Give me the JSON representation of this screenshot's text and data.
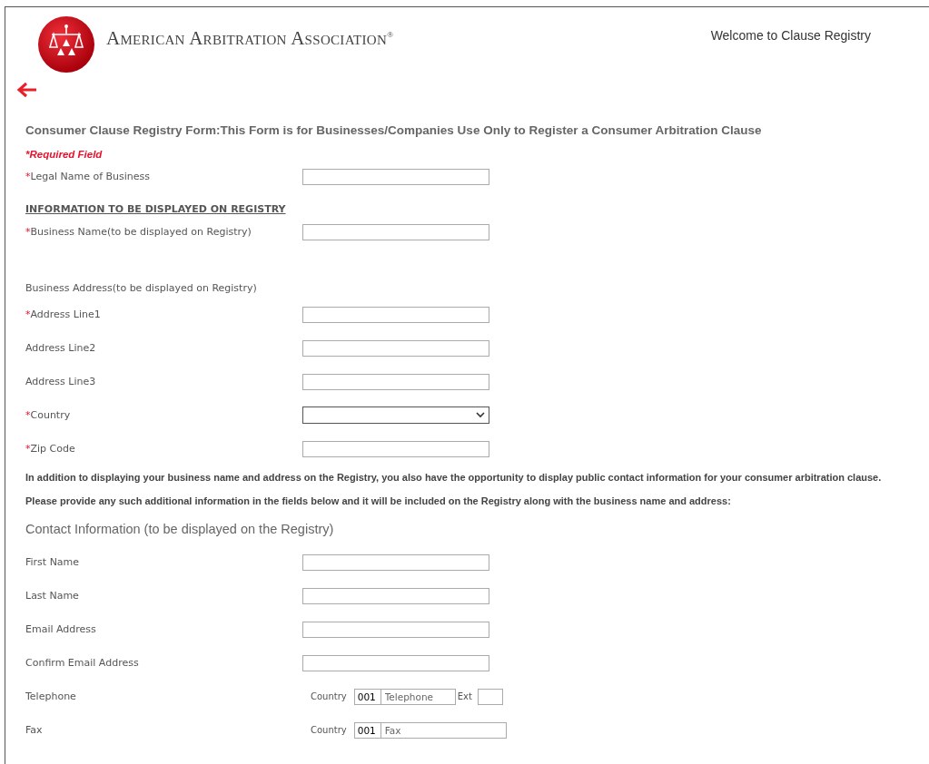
{
  "header": {
    "brand": "American Arbitration Association$^{®}$",
    "welcome": "Welcome to Clause Registry"
  },
  "form": {
    "title": "Consumer Clause Registry Form:This Form is for Businesses/Companies Use Only to Register a Consumer Arbitration Clause",
    "required_note": "*Required Field",
    "items": [
      {
        "kind": "text",
        "marker": "*",
        "label": "Legal Name of Business"
      },
      {
        "kind": "heading",
        "label": "INFORMATION TO BE DISPLAYED ON REGISTRY"
      },
      {
        "kind": "text",
        "marker": "*",
        "label": "Business Name(to be displayed on Registry)"
      },
      {
        "kind": "caption",
        "label": "Business Address(to be displayed on Registry)"
      },
      {
        "kind": "text",
        "marker": "*",
        "label": "Address Line1"
      },
      {
        "kind": "text",
        "label": "Address Line2"
      },
      {
        "kind": "text",
        "label": "Address Line3"
      },
      {
        "kind": "select",
        "marker": "*",
        "label": "Country"
      },
      {
        "kind": "text",
        "marker": "*",
        "label": "Zip Code"
      },
      {
        "kind": "paragraph",
        "label": "In addition to displaying your business name and address on the Registry, you also have the opportunity to display public contact information for your consumer arbitration clause."
      },
      {
        "kind": "paragraph",
        "label": "Please provide any such additional information in the fields below and it will be included on the Registry along with the business name and address:"
      },
      {
        "kind": "section",
        "label": "Contact Information (to be displayed on the Registry)"
      },
      {
        "kind": "text",
        "label": "First Name"
      },
      {
        "kind": "text",
        "label": "Last Name"
      },
      {
        "kind": "text",
        "label": "Email Address"
      },
      {
        "kind": "text",
        "label": "Confirm Email Address"
      },
      {
        "kind": "phone",
        "label": "Telephone",
        "country_label": "Country",
        "code": "001",
        "placeholder": "Telephone",
        "ext_label": "Ext"
      },
      {
        "kind": "phone",
        "label": "Fax",
        "country_label": "Country",
        "code": "001",
        "placeholder": "Fax"
      }
    ]
  }
}
